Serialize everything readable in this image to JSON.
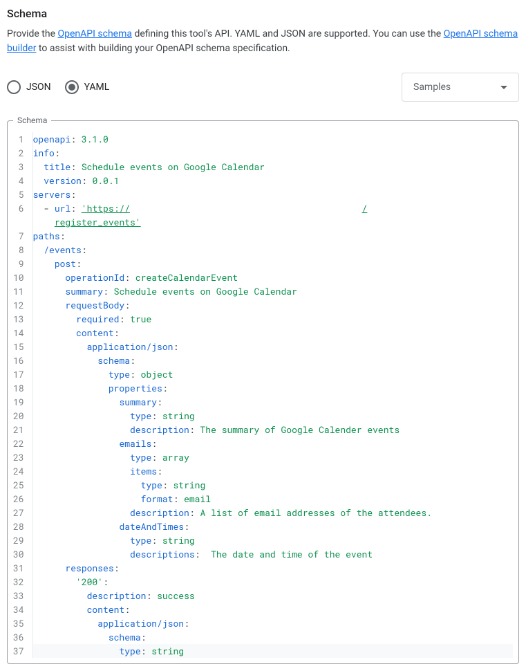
{
  "section_title": "Schema",
  "description": {
    "prefix": "Provide the ",
    "link1": "OpenAPI schema",
    "mid1": " defining this tool's API. YAML and JSON are supported. You can use the ",
    "link2": "OpenAPI schema builder",
    "mid2": " to assist with building your OpenAPI schema specification."
  },
  "radio": {
    "json_label": "JSON",
    "yaml_label": "YAML",
    "selected": "YAML"
  },
  "samples_label": "Samples",
  "fieldset_legend": "Schema",
  "code": {
    "lines": [
      {
        "n": 1,
        "parts": [
          {
            "cls": "tok-key",
            "t": "openapi"
          },
          {
            "cls": "tok-punct",
            "t": ": "
          },
          {
            "cls": "tok-str",
            "t": "3.1.0"
          }
        ]
      },
      {
        "n": 2,
        "parts": [
          {
            "cls": "tok-key",
            "t": "info"
          },
          {
            "cls": "tok-punct",
            "t": ":"
          }
        ]
      },
      {
        "n": 3,
        "parts": [
          {
            "cls": "",
            "t": "  "
          },
          {
            "cls": "tok-key",
            "t": "title"
          },
          {
            "cls": "tok-punct",
            "t": ": "
          },
          {
            "cls": "tok-str",
            "t": "Schedule events on Google Calendar"
          }
        ]
      },
      {
        "n": 4,
        "parts": [
          {
            "cls": "",
            "t": "  "
          },
          {
            "cls": "tok-key",
            "t": "version"
          },
          {
            "cls": "tok-punct",
            "t": ": "
          },
          {
            "cls": "tok-str",
            "t": "0.0.1"
          }
        ]
      },
      {
        "n": 5,
        "parts": [
          {
            "cls": "tok-key",
            "t": "servers"
          },
          {
            "cls": "tok-punct",
            "t": ":"
          }
        ]
      },
      {
        "n": 6,
        "parts": [
          {
            "cls": "",
            "t": "  "
          },
          {
            "cls": "tok-punct",
            "t": "- "
          },
          {
            "cls": "tok-key",
            "t": "url"
          },
          {
            "cls": "tok-punct",
            "t": ": "
          },
          {
            "cls": "tok-url",
            "t": "'https://"
          },
          {
            "cls": "",
            "t": "                                           "
          },
          {
            "cls": "tok-url",
            "t": "/"
          }
        ]
      },
      {
        "n": "",
        "wrap": true,
        "parts": [
          {
            "cls": "",
            "t": "    "
          },
          {
            "cls": "tok-url",
            "t": "register_events'"
          }
        ]
      },
      {
        "n": 7,
        "parts": [
          {
            "cls": "tok-key",
            "t": "paths"
          },
          {
            "cls": "tok-punct",
            "t": ":"
          }
        ]
      },
      {
        "n": 8,
        "parts": [
          {
            "cls": "",
            "t": "  "
          },
          {
            "cls": "tok-key",
            "t": "/events"
          },
          {
            "cls": "tok-punct",
            "t": ":"
          }
        ]
      },
      {
        "n": 9,
        "parts": [
          {
            "cls": "",
            "t": "    "
          },
          {
            "cls": "tok-key",
            "t": "post"
          },
          {
            "cls": "tok-punct",
            "t": ":"
          }
        ]
      },
      {
        "n": 10,
        "parts": [
          {
            "cls": "",
            "t": "      "
          },
          {
            "cls": "tok-key",
            "t": "operationId"
          },
          {
            "cls": "tok-punct",
            "t": ": "
          },
          {
            "cls": "tok-str",
            "t": "createCalendarEvent"
          }
        ]
      },
      {
        "n": 11,
        "parts": [
          {
            "cls": "",
            "t": "      "
          },
          {
            "cls": "tok-key",
            "t": "summary"
          },
          {
            "cls": "tok-punct",
            "t": ": "
          },
          {
            "cls": "tok-str",
            "t": "Schedule events on Google Calendar"
          }
        ]
      },
      {
        "n": 12,
        "parts": [
          {
            "cls": "",
            "t": "      "
          },
          {
            "cls": "tok-key",
            "t": "requestBody"
          },
          {
            "cls": "tok-punct",
            "t": ":"
          }
        ]
      },
      {
        "n": 13,
        "parts": [
          {
            "cls": "",
            "t": "        "
          },
          {
            "cls": "tok-key",
            "t": "required"
          },
          {
            "cls": "tok-punct",
            "t": ": "
          },
          {
            "cls": "tok-str",
            "t": "true"
          }
        ]
      },
      {
        "n": 14,
        "parts": [
          {
            "cls": "",
            "t": "        "
          },
          {
            "cls": "tok-key",
            "t": "content"
          },
          {
            "cls": "tok-punct",
            "t": ":"
          }
        ]
      },
      {
        "n": 15,
        "parts": [
          {
            "cls": "",
            "t": "          "
          },
          {
            "cls": "tok-key",
            "t": "application/json"
          },
          {
            "cls": "tok-punct",
            "t": ":"
          }
        ]
      },
      {
        "n": 16,
        "parts": [
          {
            "cls": "",
            "t": "            "
          },
          {
            "cls": "tok-key",
            "t": "schema"
          },
          {
            "cls": "tok-punct",
            "t": ":"
          }
        ]
      },
      {
        "n": 17,
        "parts": [
          {
            "cls": "",
            "t": "              "
          },
          {
            "cls": "tok-key",
            "t": "type"
          },
          {
            "cls": "tok-punct",
            "t": ": "
          },
          {
            "cls": "tok-str",
            "t": "object"
          }
        ]
      },
      {
        "n": 18,
        "parts": [
          {
            "cls": "",
            "t": "              "
          },
          {
            "cls": "tok-key",
            "t": "properties"
          },
          {
            "cls": "tok-punct",
            "t": ":"
          }
        ]
      },
      {
        "n": 19,
        "parts": [
          {
            "cls": "",
            "t": "                "
          },
          {
            "cls": "tok-key",
            "t": "summary"
          },
          {
            "cls": "tok-punct",
            "t": ":"
          }
        ]
      },
      {
        "n": 20,
        "parts": [
          {
            "cls": "",
            "t": "                  "
          },
          {
            "cls": "tok-key",
            "t": "type"
          },
          {
            "cls": "tok-punct",
            "t": ": "
          },
          {
            "cls": "tok-str",
            "t": "string"
          }
        ]
      },
      {
        "n": 21,
        "parts": [
          {
            "cls": "",
            "t": "                  "
          },
          {
            "cls": "tok-key",
            "t": "description"
          },
          {
            "cls": "tok-punct",
            "t": ": "
          },
          {
            "cls": "tok-str",
            "t": "The summary of Google Calender events"
          }
        ]
      },
      {
        "n": 22,
        "parts": [
          {
            "cls": "",
            "t": "                "
          },
          {
            "cls": "tok-key",
            "t": "emails"
          },
          {
            "cls": "tok-punct",
            "t": ":"
          }
        ]
      },
      {
        "n": 23,
        "parts": [
          {
            "cls": "",
            "t": "                  "
          },
          {
            "cls": "tok-key",
            "t": "type"
          },
          {
            "cls": "tok-punct",
            "t": ": "
          },
          {
            "cls": "tok-str",
            "t": "array"
          }
        ]
      },
      {
        "n": 24,
        "parts": [
          {
            "cls": "",
            "t": "                  "
          },
          {
            "cls": "tok-key",
            "t": "items"
          },
          {
            "cls": "tok-punct",
            "t": ":"
          }
        ]
      },
      {
        "n": 25,
        "parts": [
          {
            "cls": "",
            "t": "                    "
          },
          {
            "cls": "tok-key",
            "t": "type"
          },
          {
            "cls": "tok-punct",
            "t": ": "
          },
          {
            "cls": "tok-str",
            "t": "string"
          }
        ]
      },
      {
        "n": 26,
        "parts": [
          {
            "cls": "",
            "t": "                    "
          },
          {
            "cls": "tok-key",
            "t": "format"
          },
          {
            "cls": "tok-punct",
            "t": ": "
          },
          {
            "cls": "tok-str",
            "t": "email"
          }
        ]
      },
      {
        "n": 27,
        "parts": [
          {
            "cls": "",
            "t": "                  "
          },
          {
            "cls": "tok-key",
            "t": "description"
          },
          {
            "cls": "tok-punct",
            "t": ": "
          },
          {
            "cls": "tok-str",
            "t": "A list of email addresses of the attendees."
          }
        ]
      },
      {
        "n": 28,
        "parts": [
          {
            "cls": "",
            "t": "                "
          },
          {
            "cls": "tok-key",
            "t": "dateAndTimes"
          },
          {
            "cls": "tok-punct",
            "t": ":"
          }
        ]
      },
      {
        "n": 29,
        "parts": [
          {
            "cls": "",
            "t": "                  "
          },
          {
            "cls": "tok-key",
            "t": "type"
          },
          {
            "cls": "tok-punct",
            "t": ": "
          },
          {
            "cls": "tok-str",
            "t": "string"
          }
        ]
      },
      {
        "n": 30,
        "parts": [
          {
            "cls": "",
            "t": "                  "
          },
          {
            "cls": "tok-key",
            "t": "descriptions"
          },
          {
            "cls": "tok-punct",
            "t": ":  "
          },
          {
            "cls": "tok-str",
            "t": "The date and time of the event"
          }
        ]
      },
      {
        "n": 31,
        "parts": [
          {
            "cls": "",
            "t": "      "
          },
          {
            "cls": "tok-key",
            "t": "responses"
          },
          {
            "cls": "tok-punct",
            "t": ":"
          }
        ]
      },
      {
        "n": 32,
        "parts": [
          {
            "cls": "",
            "t": "        "
          },
          {
            "cls": "tok-str",
            "t": "'200'"
          },
          {
            "cls": "tok-punct",
            "t": ":"
          }
        ]
      },
      {
        "n": 33,
        "parts": [
          {
            "cls": "",
            "t": "          "
          },
          {
            "cls": "tok-key",
            "t": "description"
          },
          {
            "cls": "tok-punct",
            "t": ": "
          },
          {
            "cls": "tok-str",
            "t": "success"
          }
        ]
      },
      {
        "n": 34,
        "parts": [
          {
            "cls": "",
            "t": "          "
          },
          {
            "cls": "tok-key",
            "t": "content"
          },
          {
            "cls": "tok-punct",
            "t": ":"
          }
        ]
      },
      {
        "n": 35,
        "parts": [
          {
            "cls": "",
            "t": "            "
          },
          {
            "cls": "tok-key",
            "t": "application/json"
          },
          {
            "cls": "tok-punct",
            "t": ":"
          }
        ]
      },
      {
        "n": 36,
        "parts": [
          {
            "cls": "",
            "t": "              "
          },
          {
            "cls": "tok-key",
            "t": "schema"
          },
          {
            "cls": "tok-punct",
            "t": ":"
          }
        ]
      },
      {
        "n": 37,
        "hl": true,
        "parts": [
          {
            "cls": "",
            "t": "                "
          },
          {
            "cls": "tok-key",
            "t": "type"
          },
          {
            "cls": "tok-punct",
            "t": ": "
          },
          {
            "cls": "tok-str",
            "t": "string"
          }
        ]
      }
    ]
  }
}
